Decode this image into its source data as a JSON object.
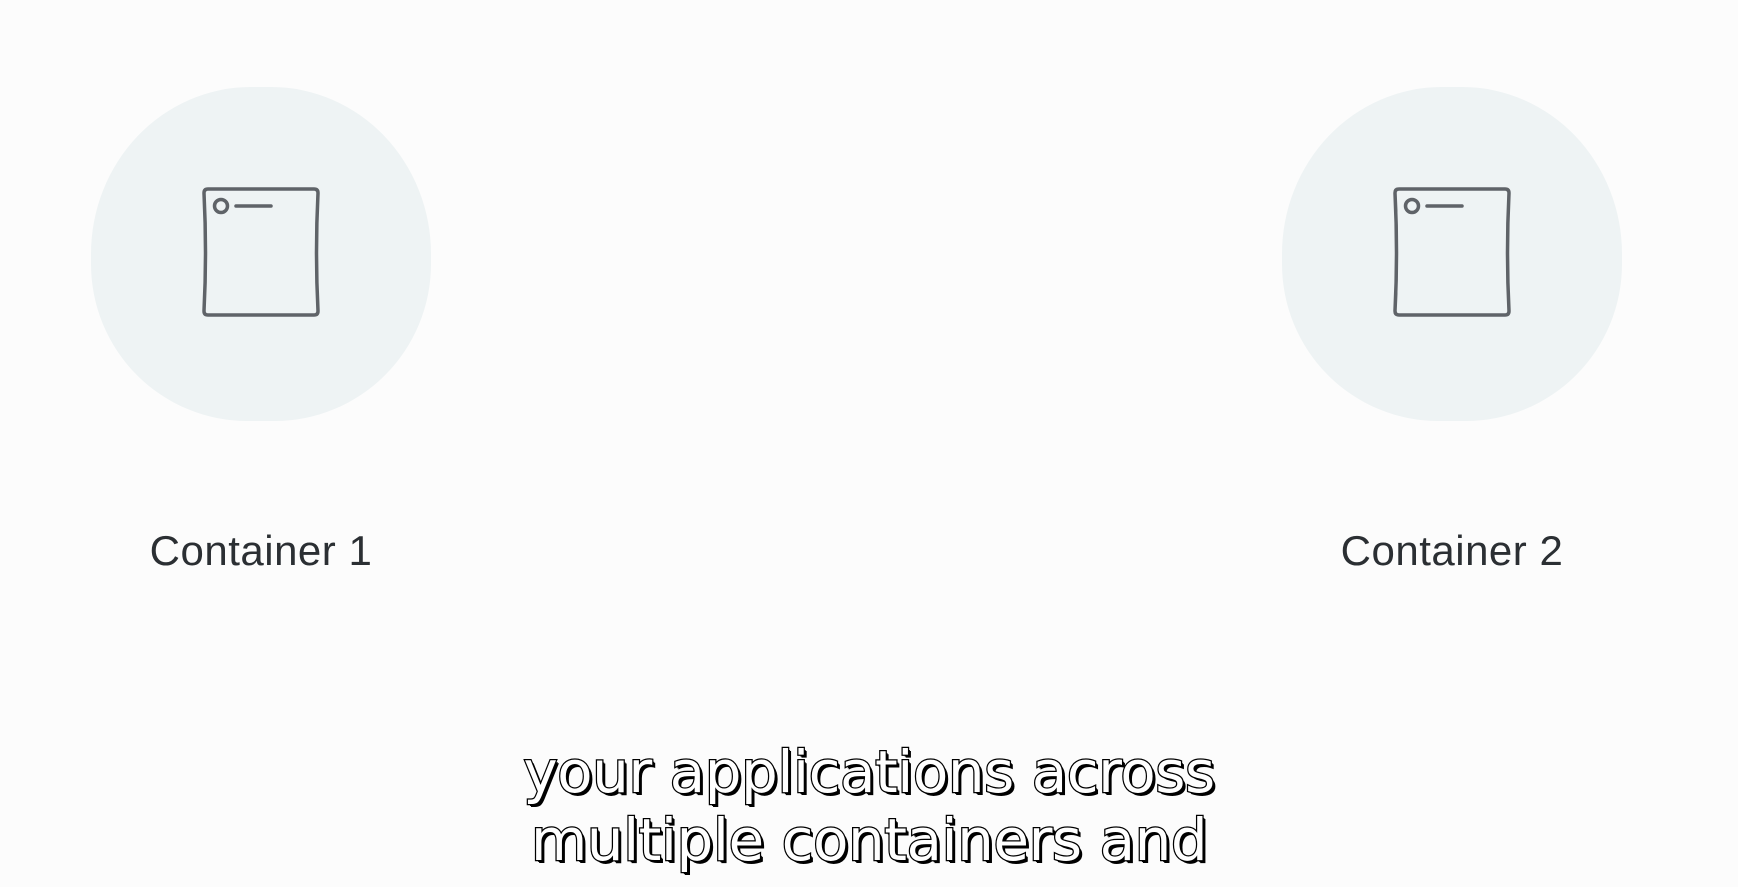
{
  "containers": [
    {
      "label": "Container 1",
      "icon": "app-window-icon"
    },
    {
      "label": "Container 2",
      "icon": "app-window-icon"
    }
  ],
  "caption": {
    "line1": "your applications across",
    "line2": "multiple containers and"
  },
  "colors": {
    "background": "#fcfcfc",
    "blob": "#eef3f4",
    "icon_stroke": "#5f6368",
    "label_text": "#2b2f33",
    "caption_fill": "#ffffff",
    "caption_outline": "#000000"
  }
}
